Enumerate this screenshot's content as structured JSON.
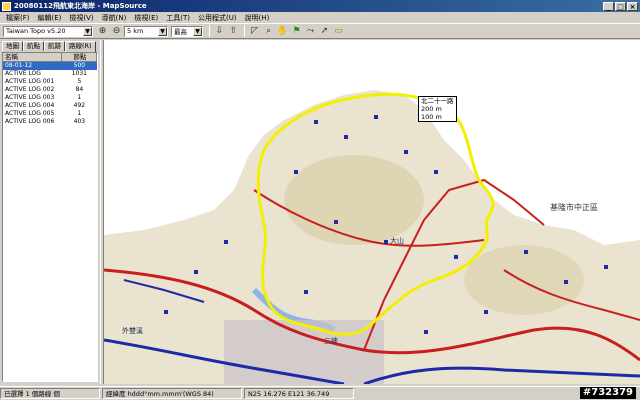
{
  "window": {
    "title": "20080112飛航東北海岸 - MapSource",
    "buttons": {
      "minimize": "_",
      "maximize": "□",
      "close": "×"
    }
  },
  "menu": [
    "檔案(F)",
    "編輯(E)",
    "檢視(V)",
    "導航(N)",
    "檢視(E)",
    "工具(T)",
    "公用程式(U)",
    "說明(H)"
  ],
  "toolbar": {
    "map_product": "Taiwan Topo v5.20",
    "zoom_level": "5 km",
    "detail": "最高",
    "icons": [
      "zoom-in-icon",
      "zoom-out-icon",
      "receive-from-device-icon",
      "send-to-device-icon",
      "selection-tool-icon",
      "zoom-tool-icon",
      "hand-tool-icon",
      "waypoint-tool-icon",
      "route-tool-icon",
      "track-tool-icon",
      "distance-tool-icon"
    ]
  },
  "left_panel": {
    "tabs": [
      "地圖",
      "航點",
      "航跡",
      "路線(R)"
    ],
    "active_tab": 3,
    "columns": {
      "name": "名稱",
      "points": "節點"
    },
    "rows": [
      {
        "name": "08-01-12",
        "points": "500"
      },
      {
        "name": "ACTIVE LOG",
        "points": "1031"
      },
      {
        "name": "ACTIVE LOG 001",
        "points": "5"
      },
      {
        "name": "ACTIVE LOG 002",
        "points": "84"
      },
      {
        "name": "ACTIVE LOG 003",
        "points": "1"
      },
      {
        "name": "ACTIVE LOG 004",
        "points": "492"
      },
      {
        "name": "ACTIVE LOG 005",
        "points": "1"
      },
      {
        "name": "ACTIVE LOG 006",
        "points": "403"
      }
    ],
    "selected_row": 0
  },
  "map": {
    "route_label": {
      "name": "北二十一路",
      "line1": "200 m",
      "line2": "100 m"
    },
    "places": [
      "基隆市中正區",
      "大山",
      "三峽",
      "外雙溪"
    ],
    "colors": {
      "land": "#e9e3cf",
      "sea": "#ffffff",
      "highway": "#c81e1e",
      "track": "#f2f000",
      "road_blue": "#1c2aa8"
    }
  },
  "status": {
    "pane1": "已選擇 1 個路線 個",
    "pane2": "經緯度 hddd°mm.mmm'(WGS 84)",
    "pane3": "N25 16.276 E121 36.749"
  },
  "watermark": "#732379"
}
